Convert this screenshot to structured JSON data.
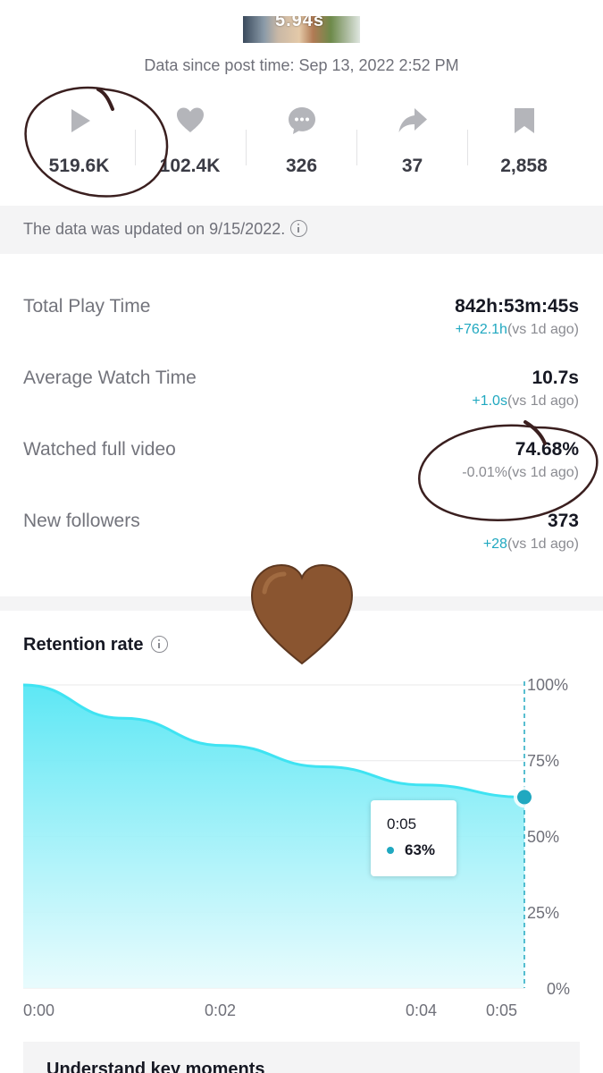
{
  "thumbnail": {
    "duration": "5.94s"
  },
  "header": {
    "since_text": "Data since post time: Sep 13, 2022 2:52 PM"
  },
  "stats": [
    {
      "icon": "play-icon",
      "value": "519.6K"
    },
    {
      "icon": "heart-icon",
      "value": "102.4K"
    },
    {
      "icon": "comment-icon",
      "value": "326"
    },
    {
      "icon": "share-icon",
      "value": "37"
    },
    {
      "icon": "bookmark-icon",
      "value": "2,858"
    }
  ],
  "updated": {
    "text": "The data was updated on 9/15/2022."
  },
  "metrics": [
    {
      "label": "Total Play Time",
      "value": "842h:53m:45s",
      "change": "+762.1h",
      "compare": "(vs 1d ago)"
    },
    {
      "label": "Average Watch Time",
      "value": "10.7s",
      "change": "+1.0s",
      "compare": "(vs 1d ago)"
    },
    {
      "label": "Watched full video",
      "value": "74.68%",
      "change": "-0.01%",
      "compare": "(vs 1d ago)"
    },
    {
      "label": "New followers",
      "value": "373",
      "change": "+28",
      "compare": "(vs 1d ago)"
    }
  ],
  "retention": {
    "title": "Retention rate",
    "tooltip": {
      "time": "0:05",
      "value": "63%"
    }
  },
  "colors": {
    "accent": "#20a8c0",
    "line": "#3fe3f2",
    "fill": "#6de8f5",
    "annotation": "#3a1f1f",
    "heart_emoji": "#8a5530"
  },
  "chart_data": {
    "type": "area",
    "x": [
      "0:00",
      "0:01",
      "0:02",
      "0:03",
      "0:04",
      "0:05"
    ],
    "values": [
      100,
      89,
      80,
      73,
      67,
      63
    ],
    "xticks": [
      "0:00",
      "0:02",
      "0:04",
      "0:05"
    ],
    "yticks": [
      "100%",
      "75%",
      "50%",
      "25%",
      "0%"
    ],
    "ylim": [
      0,
      100
    ],
    "grid": true,
    "highlight": {
      "x": "0:05",
      "value": 63
    }
  },
  "footer": {
    "title": "Understand key moments"
  }
}
